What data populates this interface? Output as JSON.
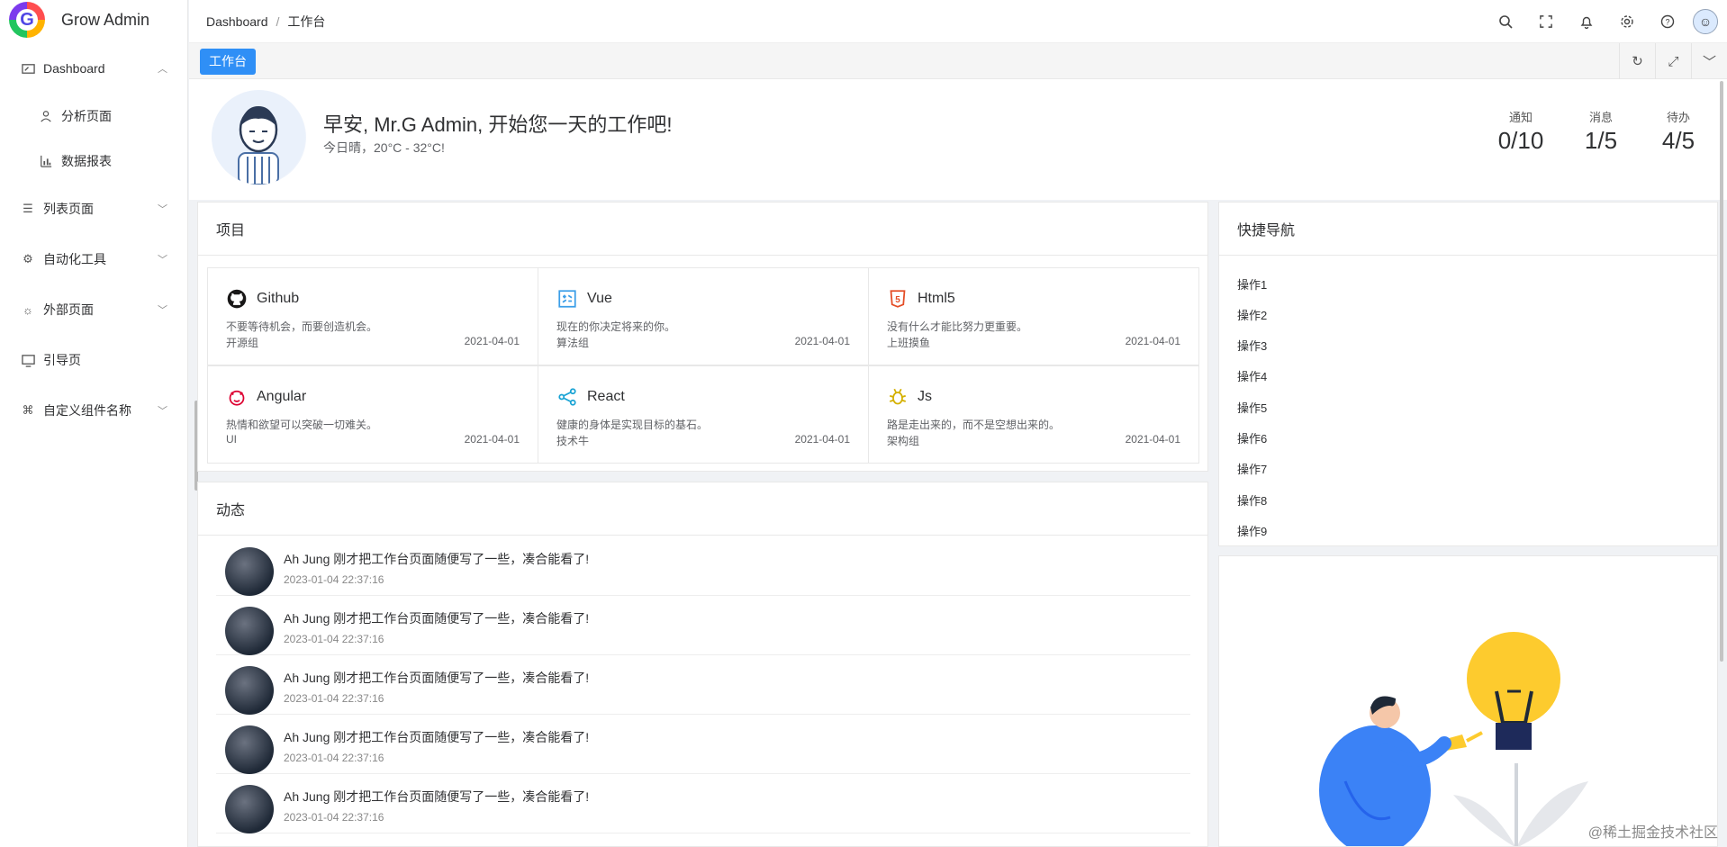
{
  "app": {
    "name": "Grow Admin"
  },
  "sidebar": {
    "items": [
      {
        "label": "Dashboard",
        "icon": "dashboard-icon",
        "arrow": "up"
      },
      {
        "label": "分析页面",
        "icon": "analysis-icon",
        "sub": true
      },
      {
        "label": "数据报表",
        "icon": "report-icon",
        "sub": true
      },
      {
        "label": "列表页面",
        "icon": "list-icon",
        "arrow": "down"
      },
      {
        "label": "自动化工具",
        "icon": "automation-icon",
        "arrow": "down"
      },
      {
        "label": "外部页面",
        "icon": "external-icon",
        "arrow": "down"
      },
      {
        "label": "引导页",
        "icon": "guide-icon"
      },
      {
        "label": "自定义组件名称",
        "icon": "component-icon",
        "arrow": "down"
      }
    ]
  },
  "header": {
    "breadcrumb": [
      "Dashboard",
      "工作台"
    ],
    "tools": [
      "search-icon",
      "fullscreen-icon",
      "bell-icon",
      "gear-icon",
      "help-icon"
    ]
  },
  "tagbar": {
    "active_tab": "工作台",
    "tools": [
      "refresh-icon",
      "maximize-icon",
      "chevron-down-icon"
    ]
  },
  "welcome": {
    "greeting": "早安, Mr.G Admin, 开始您一天的工作吧!",
    "weather": "今日晴，20°C - 32°C!",
    "stats": [
      {
        "label": "通知",
        "value": "0/10"
      },
      {
        "label": "消息",
        "value": "1/5"
      },
      {
        "label": "待办",
        "value": "4/5"
      }
    ]
  },
  "projects": {
    "title": "项目",
    "items": [
      {
        "name": "Github",
        "desc": "不要等待机会，而要创造机会。",
        "group": "开源组",
        "date": "2021-04-01",
        "icon": "github-icon",
        "color": "#181717"
      },
      {
        "name": "Vue",
        "desc": "现在的你决定将来的你。",
        "group": "算法组",
        "date": "2021-04-01",
        "icon": "vue-icon",
        "color": "#3b9ee8"
      },
      {
        "name": "Html5",
        "desc": "没有什么才能比努力更重要。",
        "group": "上班摸鱼",
        "date": "2021-04-01",
        "icon": "html5-icon",
        "color": "#e44d26"
      },
      {
        "name": "Angular",
        "desc": "热情和欲望可以突破一切难关。",
        "group": "UI",
        "date": "2021-04-01",
        "icon": "angular-icon",
        "color": "#dd0031"
      },
      {
        "name": "React",
        "desc": "健康的身体是实现目标的基石。",
        "group": "技术牛",
        "date": "2021-04-01",
        "icon": "react-icon",
        "color": "#1aa3d4"
      },
      {
        "name": "Js",
        "desc": "路是走出来的，而不是空想出来的。",
        "group": "架构组",
        "date": "2021-04-01",
        "icon": "js-icon",
        "color": "#d4b000"
      }
    ]
  },
  "dynamics": {
    "title": "动态",
    "items": [
      {
        "text": "Ah Jung 刚才把工作台页面随便写了一些，凑合能看了!",
        "time": "2023-01-04 22:37:16"
      },
      {
        "text": "Ah Jung 刚才把工作台页面随便写了一些，凑合能看了!",
        "time": "2023-01-04 22:37:16"
      },
      {
        "text": "Ah Jung 刚才把工作台页面随便写了一些，凑合能看了!",
        "time": "2023-01-04 22:37:16"
      },
      {
        "text": "Ah Jung 刚才把工作台页面随便写了一些，凑合能看了!",
        "time": "2023-01-04 22:37:16"
      },
      {
        "text": "Ah Jung 刚才把工作台页面随便写了一些，凑合能看了!",
        "time": "2023-01-04 22:37:16"
      }
    ]
  },
  "quicknav": {
    "title": "快捷导航",
    "items": [
      "操作1",
      "操作2",
      "操作3",
      "操作4",
      "操作5",
      "操作6",
      "操作7",
      "操作8",
      "操作9"
    ]
  },
  "watermark": "@稀土掘金技术社区",
  "colors": {
    "accent": "#2f8ff6",
    "bulb": "#fdcb2e"
  }
}
